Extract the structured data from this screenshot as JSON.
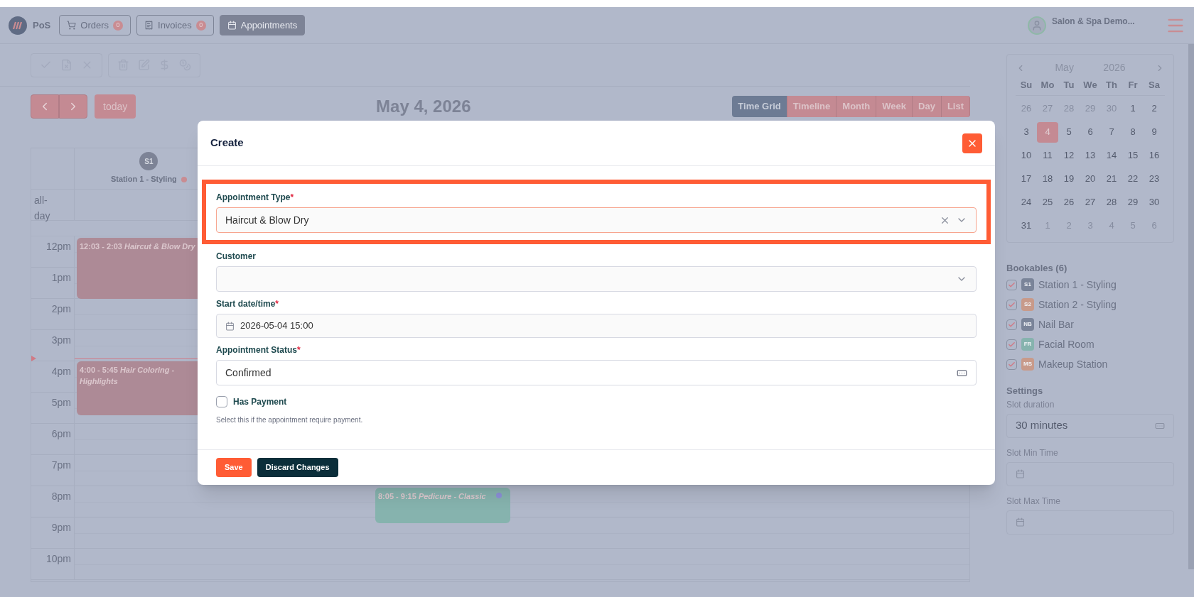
{
  "top_bar": {
    "app_name": "PoS",
    "nav": [
      {
        "label": "Orders",
        "badge": "0",
        "selected": false
      },
      {
        "label": "Invoices",
        "badge": "0",
        "selected": false
      },
      {
        "label": "Appointments",
        "selected": true
      }
    ],
    "user_name": "Salon & Spa Demo..."
  },
  "calendar": {
    "today_label": "today",
    "title": "May 4, 2026",
    "views": [
      {
        "label": "Time Grid",
        "selected": true
      },
      {
        "label": "Timeline",
        "selected": false
      },
      {
        "label": "Month",
        "selected": false
      },
      {
        "label": "Week",
        "selected": false
      },
      {
        "label": "Day",
        "selected": false
      },
      {
        "label": "List",
        "selected": false
      }
    ],
    "resource_header": {
      "initials": "S1",
      "name": "Station 1 - Styling",
      "color": "#c98c92"
    },
    "all_day_label": "all-day",
    "hours": [
      "12pm",
      "1pm",
      "2pm",
      "3pm",
      "4pm",
      "5pm",
      "6pm",
      "7pm",
      "8pm",
      "9pm",
      "10pm"
    ],
    "events": [
      {
        "time": "12:03 - 2:03",
        "title": "Haircut & Blow Dry",
        "color": "#ad8a96"
      },
      {
        "time": "4:00 - 5:45",
        "title": "Hair Coloring - Highlights",
        "color": "#ad8a96"
      },
      {
        "time": "8:05 - 9:15",
        "title": "Pedicure - Classic",
        "color": "#86b3ae"
      }
    ]
  },
  "mini_calendar": {
    "month": "May",
    "year": "2026",
    "weekdays": [
      "Su",
      "Mo",
      "Tu",
      "We",
      "Th",
      "Fr",
      "Sa"
    ],
    "days": [
      {
        "label": "26",
        "in_month": false,
        "selected": false
      },
      {
        "label": "27",
        "in_month": false,
        "selected": false
      },
      {
        "label": "28",
        "in_month": false,
        "selected": false
      },
      {
        "label": "29",
        "in_month": false,
        "selected": false
      },
      {
        "label": "30",
        "in_month": false,
        "selected": false
      },
      {
        "label": "1",
        "in_month": true,
        "selected": false
      },
      {
        "label": "2",
        "in_month": true,
        "selected": false
      },
      {
        "label": "3",
        "in_month": true,
        "selected": false
      },
      {
        "label": "4",
        "in_month": true,
        "selected": true
      },
      {
        "label": "5",
        "in_month": true,
        "selected": false
      },
      {
        "label": "6",
        "in_month": true,
        "selected": false
      },
      {
        "label": "7",
        "in_month": true,
        "selected": false
      },
      {
        "label": "8",
        "in_month": true,
        "selected": false
      },
      {
        "label": "9",
        "in_month": true,
        "selected": false
      },
      {
        "label": "10",
        "in_month": true,
        "selected": false
      },
      {
        "label": "11",
        "in_month": true,
        "selected": false
      },
      {
        "label": "12",
        "in_month": true,
        "selected": false
      },
      {
        "label": "13",
        "in_month": true,
        "selected": false
      },
      {
        "label": "14",
        "in_month": true,
        "selected": false
      },
      {
        "label": "15",
        "in_month": true,
        "selected": false
      },
      {
        "label": "16",
        "in_month": true,
        "selected": false
      },
      {
        "label": "17",
        "in_month": true,
        "selected": false
      },
      {
        "label": "18",
        "in_month": true,
        "selected": false
      },
      {
        "label": "19",
        "in_month": true,
        "selected": false
      },
      {
        "label": "20",
        "in_month": true,
        "selected": false
      },
      {
        "label": "21",
        "in_month": true,
        "selected": false
      },
      {
        "label": "22",
        "in_month": true,
        "selected": false
      },
      {
        "label": "23",
        "in_month": true,
        "selected": false
      },
      {
        "label": "24",
        "in_month": true,
        "selected": false
      },
      {
        "label": "25",
        "in_month": true,
        "selected": false
      },
      {
        "label": "26",
        "in_month": true,
        "selected": false
      },
      {
        "label": "27",
        "in_month": true,
        "selected": false
      },
      {
        "label": "28",
        "in_month": true,
        "selected": false
      },
      {
        "label": "29",
        "in_month": true,
        "selected": false
      },
      {
        "label": "30",
        "in_month": true,
        "selected": false
      },
      {
        "label": "31",
        "in_month": true,
        "selected": false
      },
      {
        "label": "1",
        "in_month": false,
        "selected": false
      },
      {
        "label": "2",
        "in_month": false,
        "selected": false
      },
      {
        "label": "3",
        "in_month": false,
        "selected": false
      },
      {
        "label": "4",
        "in_month": false,
        "selected": false
      },
      {
        "label": "5",
        "in_month": false,
        "selected": false
      },
      {
        "label": "6",
        "in_month": false,
        "selected": false
      }
    ]
  },
  "bookables": {
    "title": "Bookables (6)",
    "items": [
      {
        "initials": "S1",
        "name": "Station 1 - Styling",
        "color": "#7a8499",
        "checked": true
      },
      {
        "initials": "S2",
        "name": "Station 2 - Styling",
        "color": "#c89a8a",
        "checked": true
      },
      {
        "initials": "NB",
        "name": "Nail Bar",
        "color": "#7a8499",
        "checked": true
      },
      {
        "initials": "FR",
        "name": "Facial Room",
        "color": "#86b3ae",
        "checked": true
      },
      {
        "initials": "MS",
        "name": "Makeup Station",
        "color": "#c89a8a",
        "checked": true
      }
    ]
  },
  "settings": {
    "title": "Settings",
    "slot_duration": {
      "label": "Slot duration",
      "value": "30 minutes"
    },
    "slot_min_time": {
      "label": "Slot Min Time"
    },
    "slot_max_time": {
      "label": "Slot Max Time"
    }
  },
  "modal": {
    "title": "Create",
    "fields": [
      {
        "kind": "select",
        "label": "Appointment Type",
        "required_mark": "*",
        "value": "Haircut & Blow Dry",
        "clearable": true,
        "highlighted": true
      },
      {
        "kind": "select",
        "label": "Customer",
        "clearable": false,
        "highlighted": false
      },
      {
        "kind": "date",
        "label": "Start date/time",
        "required_mark": "*",
        "value": "2026-05-04 15:00",
        "highlighted": false
      },
      {
        "kind": "status",
        "label": "Appointment Status",
        "required_mark": "*",
        "value": "Confirmed",
        "highlighted": false
      }
    ],
    "checkbox": {
      "label": "Has Payment",
      "checked": false,
      "help": "Select this if the appointment require payment."
    },
    "buttons": [
      {
        "label": "Save",
        "kind": "primary"
      },
      {
        "label": "Discard Changes",
        "kind": "secondary"
      }
    ]
  }
}
